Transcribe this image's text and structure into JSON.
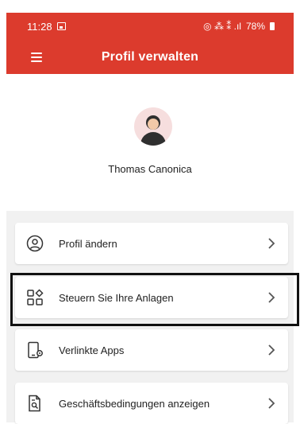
{
  "status_bar": {
    "time": "11:28",
    "indicators": "⧈ ⁘ ∷ .ıl",
    "battery": "78%"
  },
  "header": {
    "title": "Profil verwalten"
  },
  "profile": {
    "name": "Thomas Canonica"
  },
  "menu": {
    "items": [
      {
        "label": "Profil ändern",
        "icon": "user-circle-icon"
      },
      {
        "label": "Steuern Sie Ihre Anlagen",
        "icon": "devices-grid-icon"
      },
      {
        "label": "Verlinkte Apps",
        "icon": "linked-phone-icon"
      },
      {
        "label": "Geschäftsbedingungen anzeigen",
        "icon": "document-search-icon"
      }
    ]
  },
  "colors": {
    "brand": "#dc3b2d",
    "highlight_border": "#111111"
  }
}
